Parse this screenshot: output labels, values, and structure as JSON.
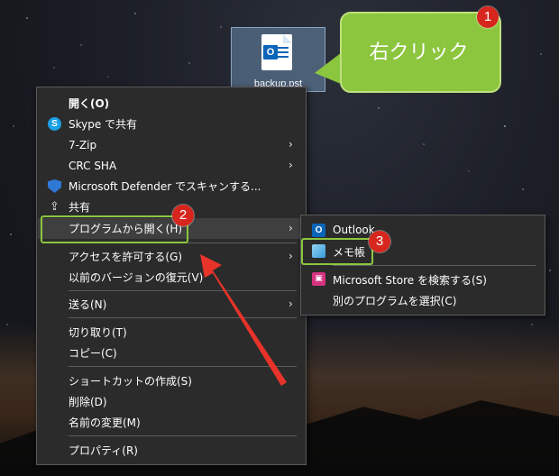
{
  "desktop": {
    "file": {
      "name": "backup.pst",
      "icon": "outlook-file-icon"
    }
  },
  "callout": {
    "text": "右クリック"
  },
  "badges": [
    "1",
    "2",
    "3"
  ],
  "context_menu": {
    "items": [
      {
        "label": "開く(O)",
        "bold": true
      },
      {
        "label": "Skype で共有",
        "icon": "skype-icon"
      },
      {
        "label": "7-Zip",
        "submenu": true
      },
      {
        "label": "CRC SHA",
        "submenu": true
      },
      {
        "label": "Microsoft Defender でスキャンする...",
        "icon": "defender-shield-icon"
      },
      {
        "label": "共有",
        "icon": "share-icon"
      },
      {
        "label": "プログラムから開く(H)",
        "submenu": true,
        "highlighted": true
      },
      {
        "label": "アクセスを許可する(G)",
        "submenu": true
      },
      {
        "label": "以前のバージョンの復元(V)"
      },
      {
        "label": "送る(N)",
        "submenu": true
      },
      {
        "label": "切り取り(T)"
      },
      {
        "label": "コピー(C)"
      },
      {
        "label": "ショートカットの作成(S)"
      },
      {
        "label": "削除(D)"
      },
      {
        "label": "名前の変更(M)"
      },
      {
        "label": "プロパティ(R)"
      }
    ]
  },
  "submenu": {
    "items": [
      {
        "label": "Outlook",
        "icon": "outlook-icon"
      },
      {
        "label": "メモ帳",
        "icon": "notepad-icon"
      },
      {
        "label": "Microsoft Store を検索する(S)",
        "icon": "store-icon"
      },
      {
        "label": "別のプログラムを選択(C)"
      }
    ]
  },
  "colors": {
    "menu_bg": "#2b2b2b",
    "highlight": "#8cc63f",
    "badge": "#d7261e",
    "arrow": "#e8332a"
  }
}
